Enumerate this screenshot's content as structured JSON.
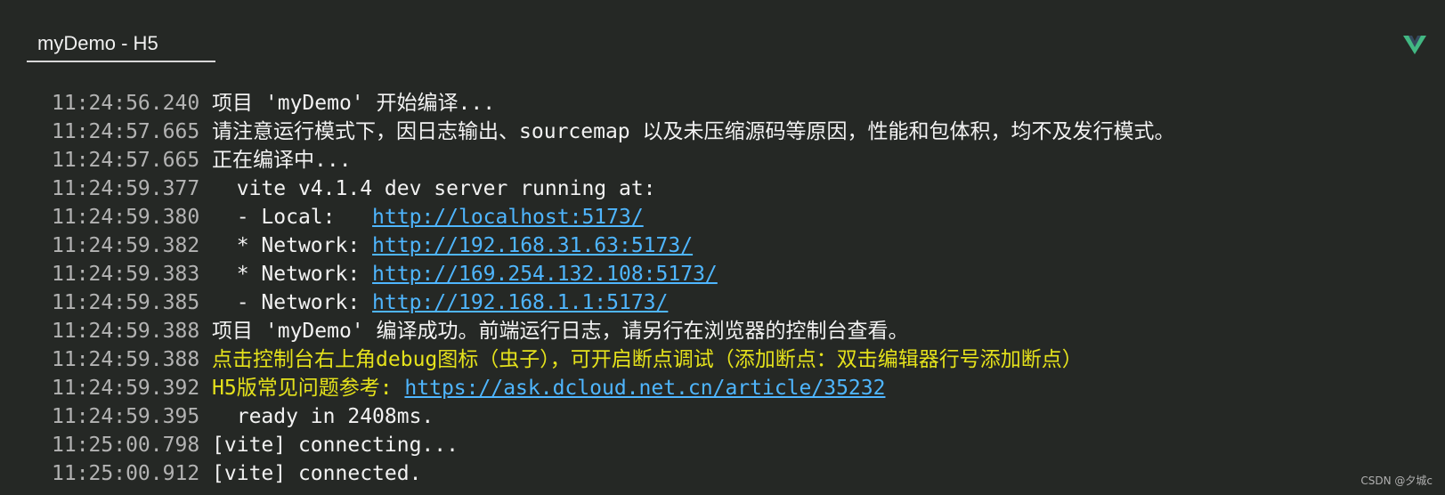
{
  "tab": {
    "title": "myDemo - H5"
  },
  "colors": {
    "background": "#252825",
    "timestamp": "#b3b3b3",
    "text": "#f2f2f2",
    "highlight": "#e5e21c",
    "link": "#4fb6ff",
    "vue_green": "#42b883"
  },
  "icons": {
    "logo": "vue-logo-icon"
  },
  "console": {
    "lines": [
      {
        "time": "11:24:56.240",
        "text": "项目 'myDemo' 开始编译..."
      },
      {
        "time": "11:24:57.665",
        "text": "请注意运行模式下，因日志输出、sourcemap 以及未压缩源码等原因，性能和包体积，均不及发行模式。"
      },
      {
        "time": "11:24:57.665",
        "text": "正在编译中..."
      },
      {
        "time": "11:24:59.377",
        "text": "  vite v4.1.4 dev server running at:"
      },
      {
        "time": "11:24:59.380",
        "prefix": "  - Local:   ",
        "link": "http://localhost:5173/"
      },
      {
        "time": "11:24:59.382",
        "prefix": "  * Network: ",
        "link": "http://192.168.31.63:5173/"
      },
      {
        "time": "11:24:59.383",
        "prefix": "  * Network: ",
        "link": "http://169.254.132.108:5173/"
      },
      {
        "time": "11:24:59.385",
        "prefix": "  - Network: ",
        "link": "http://192.168.1.1:5173/"
      },
      {
        "time": "11:24:59.388",
        "text": "项目 'myDemo' 编译成功。前端运行日志，请另行在浏览器的控制台查看。"
      },
      {
        "time": "11:24:59.388",
        "text": "点击控制台右上角debug图标（虫子），可开启断点调试（添加断点：双击编辑器行号添加断点）"
      },
      {
        "time": "11:24:59.392",
        "prefix": "H5版常见问题参考: ",
        "link": "https://ask.dcloud.net.cn/article/35232"
      },
      {
        "time": "11:24:59.395",
        "text": "  ready in 2408ms."
      },
      {
        "time": "11:25:00.798",
        "text": "[vite] connecting..."
      },
      {
        "time": "11:25:00.912",
        "text": "[vite] connected."
      }
    ]
  },
  "watermark": "CSDN @夕城c"
}
